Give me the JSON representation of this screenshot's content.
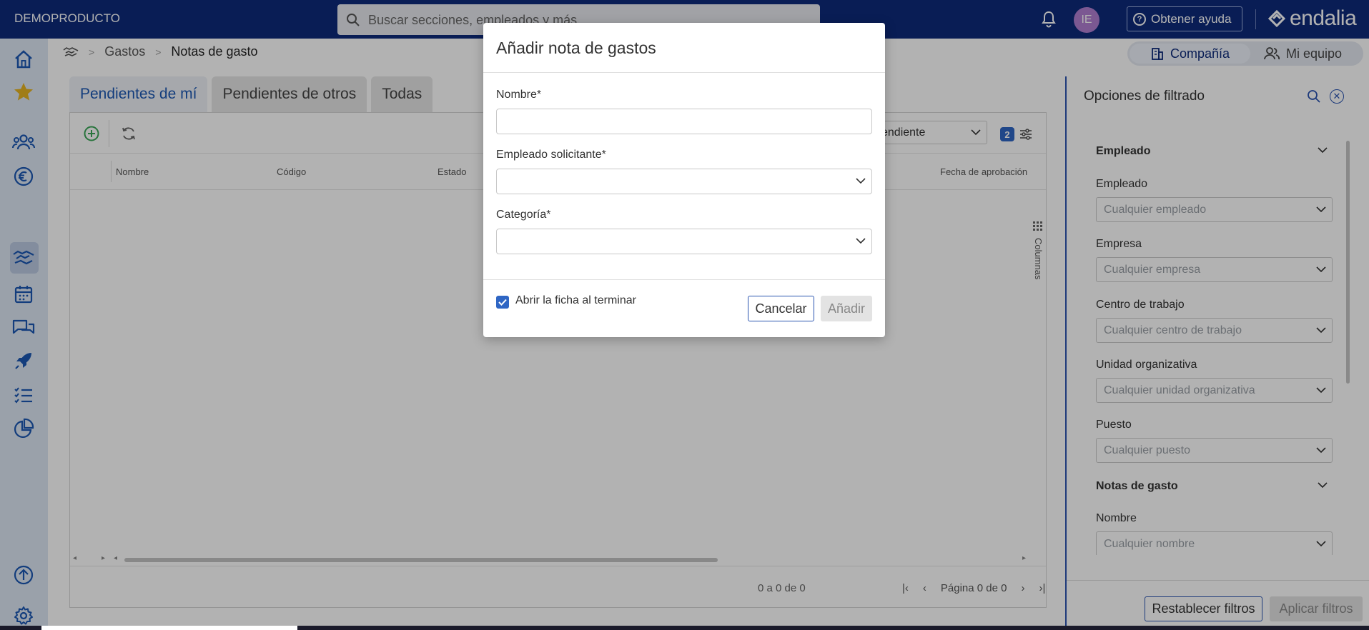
{
  "app": {
    "brand": "DEMOPRODUCTO",
    "logo_text": "endalia"
  },
  "search": {
    "placeholder": "Buscar secciones, empleados y más"
  },
  "header": {
    "avatar_initials": "IE",
    "help_label": "Obtener ayuda"
  },
  "breadcrumb": {
    "items": [
      "Gastos",
      "Notas de gasto"
    ]
  },
  "scope_toggle": {
    "company": "Compañía",
    "team": "Mi equipo"
  },
  "tabs": [
    "Pendientes de mí",
    "Pendientes de otros",
    "Todas"
  ],
  "grid": {
    "status_select_fragment": "endiente",
    "filter_count": "2",
    "columns": [
      "Nombre",
      "Código",
      "Estado",
      "Fecha de aprobación"
    ],
    "columns_panel": "Columnas",
    "count_text": "0 a 0 de 0",
    "page_text": "Página 0 de 0"
  },
  "filters": {
    "title": "Opciones de filtrado",
    "sections": [
      "Empleado",
      "Notas de gasto"
    ],
    "fields": [
      {
        "label": "Empleado",
        "placeholder": "Cualquier empleado"
      },
      {
        "label": "Empresa",
        "placeholder": "Cualquier empresa"
      },
      {
        "label": "Centro de trabajo",
        "placeholder": "Cualquier centro de trabajo"
      },
      {
        "label": "Unidad organizativa",
        "placeholder": "Cualquier unidad organizativa"
      },
      {
        "label": "Puesto",
        "placeholder": "Cualquier puesto"
      },
      {
        "label": "Nombre",
        "placeholder": "Cualquier nombre"
      }
    ],
    "reset_label": "Restablecer filtros",
    "apply_label": "Aplicar filtros"
  },
  "modal": {
    "title": "Añadir nota de gastos",
    "name_label": "Nombre*",
    "name_value": "",
    "employee_label": "Empleado solicitante*",
    "category_label": "Categoría*",
    "open_after_label": "Abrir la ficha al terminar",
    "open_after_checked": true,
    "cancel_label": "Cancelar",
    "add_label": "Añadir"
  },
  "colors": {
    "topbar": "#0d2a7a",
    "accent": "#2f66c4",
    "sidebar": "#dde7f4",
    "star": "#e6b422",
    "add_green": "#3aa657"
  },
  "icons": {
    "sidebar": [
      "home-icon",
      "star-icon",
      "people-icon",
      "euro-icon",
      "handshake-icon",
      "calendar-icon",
      "chat-icon",
      "rocket-icon",
      "checklist-icon",
      "pie-chart-icon",
      "upload-icon",
      "gear-icon"
    ]
  }
}
